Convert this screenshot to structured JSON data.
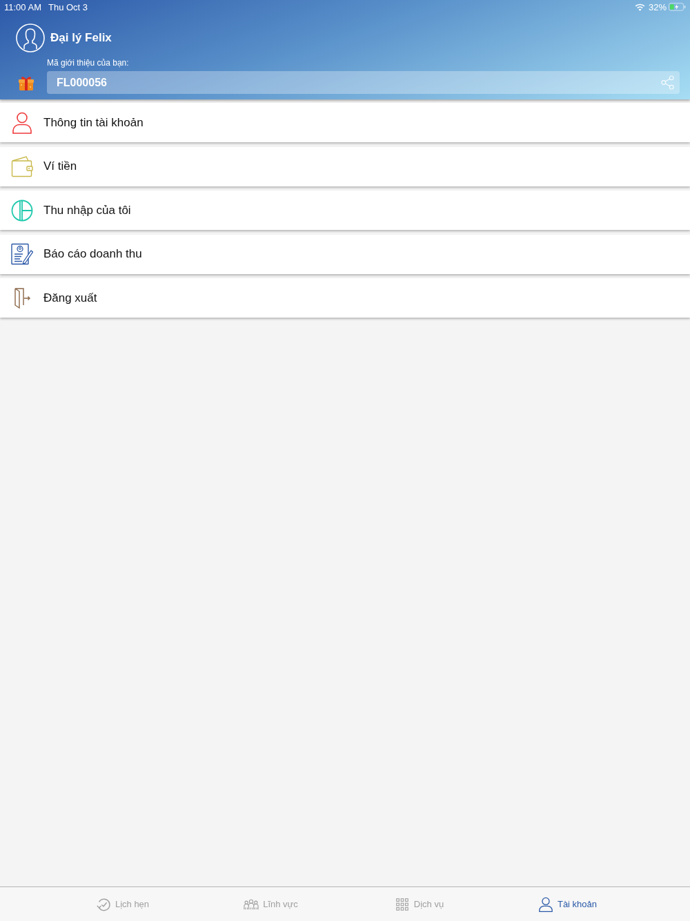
{
  "status_bar": {
    "time": "11:00 AM",
    "date": "Thu Oct 3",
    "battery": "32%"
  },
  "header": {
    "name": "Đại lý Felix",
    "referral_label": "Mã giới thiệu của bạn:",
    "referral_code": "FL000056"
  },
  "menu": [
    {
      "kind": "account",
      "label": "Thông tin tài khoản"
    },
    {
      "kind": "wallet",
      "label": "Ví tiền"
    },
    {
      "kind": "income",
      "label": "Thu nhập của tôi"
    },
    {
      "kind": "report",
      "label": "Báo cáo doanh thu"
    },
    {
      "kind": "logout",
      "label": "Đăng xuất"
    }
  ],
  "tab_bar": [
    {
      "kind": "schedule",
      "label": "Lịch hẹn",
      "selected": false
    },
    {
      "kind": "fields",
      "label": "Lĩnh vực",
      "selected": false
    },
    {
      "kind": "services",
      "label": "Dịch vụ",
      "selected": false
    },
    {
      "kind": "account",
      "label": "Tài khoản",
      "selected": true
    }
  ]
}
